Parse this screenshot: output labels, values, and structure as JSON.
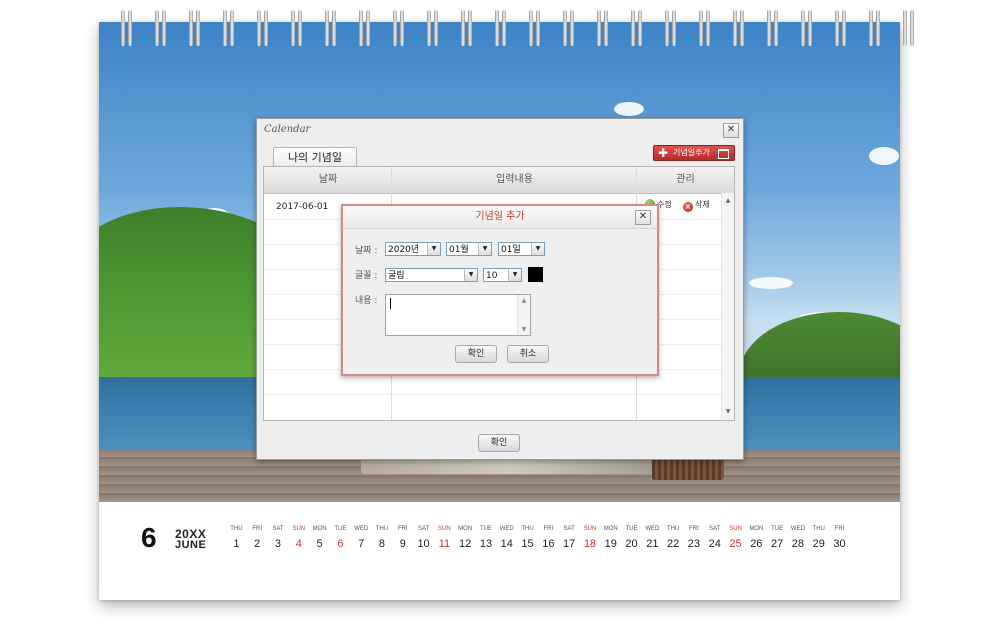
{
  "calendar_window": {
    "title": "Calendar",
    "close_symbol": "✕",
    "tab_label": "나의 기념일",
    "add_button_label": "기념일추가",
    "columns": [
      "날짜",
      "입력내용",
      "관리"
    ],
    "rows": [
      {
        "date": "2017-06-01",
        "edit_label": "수정",
        "delete_label": "삭제"
      }
    ],
    "confirm_label": "확인"
  },
  "dialog": {
    "title": "기념일 추가",
    "close_symbol": "✕",
    "date_label": "날짜 :",
    "year_value": "2020년",
    "month_value": "01월",
    "day_value": "01일",
    "font_label": "글꼴 :",
    "font_value": "굴림",
    "size_value": "10",
    "color_value": "#000000",
    "content_label": "내용 :",
    "content_value": "",
    "confirm_label": "확인",
    "cancel_label": "취소"
  },
  "desk_calendar": {
    "month_number": "6",
    "year": "20XX",
    "month_name": "JUNE",
    "sunday_color": "#d9312b",
    "days": [
      {
        "dow": "THU",
        "num": "1"
      },
      {
        "dow": "FRI",
        "num": "2"
      },
      {
        "dow": "SAT",
        "num": "3"
      },
      {
        "dow": "SUN",
        "num": "4"
      },
      {
        "dow": "MON",
        "num": "5"
      },
      {
        "dow": "TUE",
        "num": "6"
      },
      {
        "dow": "WED",
        "num": "7"
      },
      {
        "dow": "THU",
        "num": "8"
      },
      {
        "dow": "FRI",
        "num": "9"
      },
      {
        "dow": "SAT",
        "num": "10"
      },
      {
        "dow": "SUN",
        "num": "11"
      },
      {
        "dow": "MON",
        "num": "12"
      },
      {
        "dow": "TUE",
        "num": "13"
      },
      {
        "dow": "WED",
        "num": "14"
      },
      {
        "dow": "THU",
        "num": "15"
      },
      {
        "dow": "FRI",
        "num": "16"
      },
      {
        "dow": "SAT",
        "num": "17"
      },
      {
        "dow": "SUN",
        "num": "18"
      },
      {
        "dow": "MON",
        "num": "19"
      },
      {
        "dow": "TUE",
        "num": "20"
      },
      {
        "dow": "WED",
        "num": "21"
      },
      {
        "dow": "THU",
        "num": "22"
      },
      {
        "dow": "FRI",
        "num": "23"
      },
      {
        "dow": "SAT",
        "num": "24"
      },
      {
        "dow": "SUN",
        "num": "25"
      },
      {
        "dow": "MON",
        "num": "26"
      },
      {
        "dow": "TUE",
        "num": "27"
      },
      {
        "dow": "WED",
        "num": "28"
      },
      {
        "dow": "THU",
        "num": "29"
      },
      {
        "dow": "FRI",
        "num": "30"
      }
    ],
    "red_numbers": [
      "6"
    ]
  }
}
